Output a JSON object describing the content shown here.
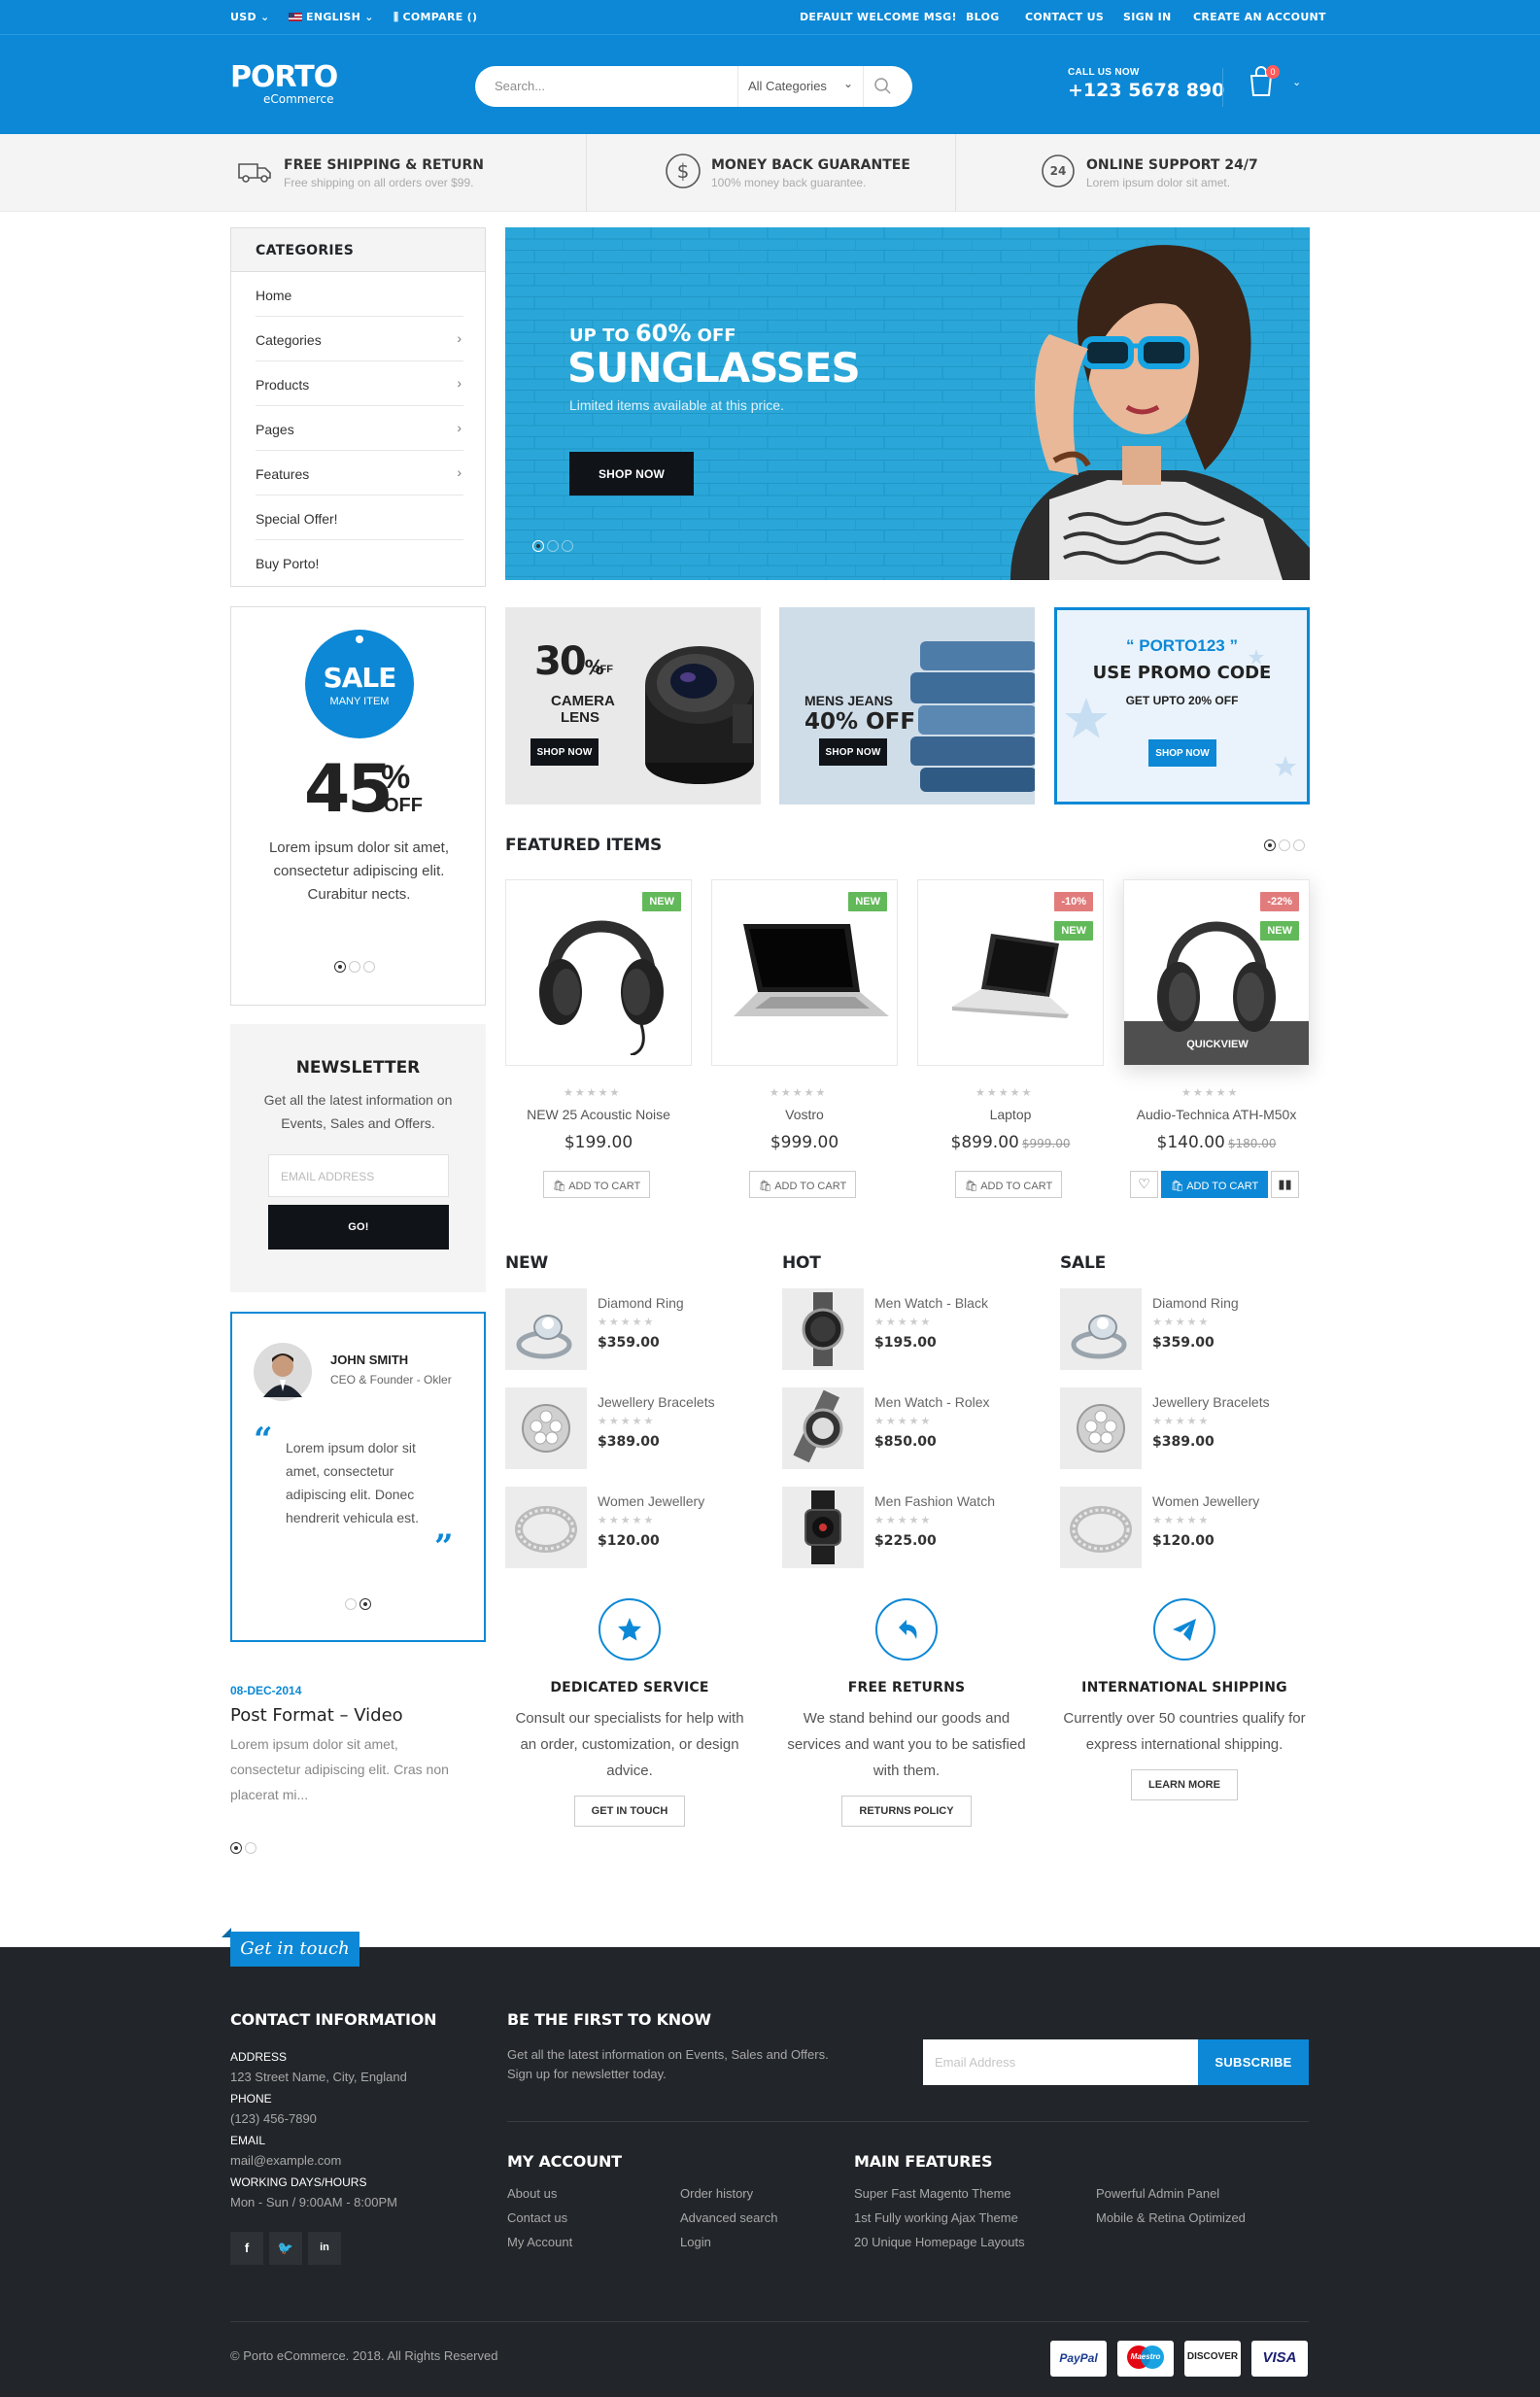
{
  "topbar": {
    "currency": "USD",
    "language": "ENGLISH",
    "compare": "COMPARE ()",
    "links": [
      "DEFAULT WELCOME MSG!",
      "BLOG",
      "CONTACT US",
      "SIGN IN",
      "CREATE AN ACCOUNT"
    ]
  },
  "header": {
    "logo_main": "PORTO",
    "logo_sub": "eCommerce",
    "search_placeholder": "Search...",
    "search_category": "All Categories",
    "call_label": "CALL US NOW",
    "phone": "+123 5678 890",
    "cart_count": "0"
  },
  "features": [
    {
      "title": "FREE SHIPPING & RETURN",
      "sub": "Free shipping on all orders over $99.",
      "icon": "truck-icon"
    },
    {
      "title": "MONEY BACK GUARANTEE",
      "sub": "100% money back guarantee.",
      "icon": "dollar-icon"
    },
    {
      "title": "ONLINE SUPPORT 24/7",
      "sub": "Lorem ipsum dolor sit amet.",
      "icon": "support-24-icon"
    }
  ],
  "categories": {
    "title": "CATEGORIES",
    "items": [
      "Home",
      "Categories",
      "Products",
      "Pages",
      "Features",
      "Special Offer!",
      "Buy Porto!"
    ]
  },
  "hero": {
    "pre": "UP TO",
    "percent": "60%",
    "off": "OFF",
    "title": "SUNGLASSES",
    "sub": "Limited items available at this price.",
    "button": "SHOP NOW"
  },
  "banners": {
    "camera": {
      "percent": "30",
      "pct_sign": "%",
      "off": "OFF",
      "line1": "CAMERA",
      "line2": "LENS",
      "button": "SHOP NOW"
    },
    "jeans": {
      "line1": "MENS JEANS",
      "line2": "40% OFF",
      "button": "SHOP NOW"
    },
    "promo": {
      "code": "“ PORTO123 ”",
      "line1": "USE PROMO CODE",
      "line2": "GET UPTO 20% OFF",
      "button": "SHOP NOW"
    }
  },
  "sale_box": {
    "badge_big": "SALE",
    "badge_small": "MANY ITEM",
    "percent": "45",
    "pct_sign": "%",
    "off": "OFF",
    "text": "Lorem ipsum dolor sit amet, consectetur adipiscing elit. Curabitur nects."
  },
  "newsletter": {
    "title": "NEWSLETTER",
    "text": "Get all the latest information on Events, Sales and Offers.",
    "placeholder": "EMAIL ADDRESS",
    "button": "GO!"
  },
  "testimonial": {
    "name": "JOHN SMITH",
    "role": "CEO & Founder - Okler",
    "quote": "Lorem ipsum dolor sit amet, consectetur adipiscing elit. Donec hendrerit vehicula est."
  },
  "blog": {
    "date": "08-DEC-2014",
    "title": "Post Format – Video",
    "excerpt": "Lorem ipsum dolor sit amet, consectetur adipiscing elit. Cras non placerat mi..."
  },
  "featured": {
    "title": "FEATURED ITEMS",
    "quickview": "QUICKVIEW",
    "add_to_cart": "ADD TO CART",
    "products": [
      {
        "name": "NEW 25 Acoustic Noise",
        "price": "$199.00",
        "old": "",
        "labels": [
          "NEW"
        ]
      },
      {
        "name": "Vostro",
        "price": "$999.00",
        "old": "",
        "labels": [
          "NEW"
        ]
      },
      {
        "name": "Laptop",
        "price": "$899.00",
        "old": "$999.00",
        "labels": [
          "-10%",
          "NEW"
        ]
      },
      {
        "name": "Audio-Technica ATH-M50x",
        "price": "$140.00",
        "old": "$180.00",
        "labels": [
          "-22%",
          "NEW"
        ]
      }
    ]
  },
  "lists": [
    {
      "title": "NEW",
      "items": [
        {
          "name": "Diamond Ring",
          "price": "$359.00"
        },
        {
          "name": "Jewellery Bracelets",
          "price": "$389.00"
        },
        {
          "name": "Women Jewellery",
          "price": "$120.00"
        }
      ]
    },
    {
      "title": "HOT",
      "items": [
        {
          "name": "Men Watch - Black",
          "price": "$195.00"
        },
        {
          "name": "Men Watch - Rolex",
          "price": "$850.00"
        },
        {
          "name": "Men Fashion Watch",
          "price": "$225.00"
        }
      ]
    },
    {
      "title": "SALE",
      "items": [
        {
          "name": "Diamond Ring",
          "price": "$359.00"
        },
        {
          "name": "Jewellery Bracelets",
          "price": "$389.00"
        },
        {
          "name": "Women Jewellery",
          "price": "$120.00"
        }
      ]
    }
  ],
  "services": [
    {
      "title": "DEDICATED SERVICE",
      "text": "Consult our specialists for help with an order, customization, or design advice.",
      "button": "GET IN TOUCH",
      "icon": "star-icon"
    },
    {
      "title": "FREE RETURNS",
      "text": "We stand behind our goods and services and want you to be satisfied with them.",
      "button": "RETURNS POLICY",
      "icon": "return-icon"
    },
    {
      "title": "INTERNATIONAL SHIPPING",
      "text": "Currently over 50 countries qualify for express international shipping.",
      "button": "LEARN MORE",
      "icon": "paper-plane-icon"
    }
  ],
  "footer": {
    "ribbon": "Get in touch",
    "contact_title": "CONTACT INFORMATION",
    "address_label": "ADDRESS",
    "address": "123 Street Name, City, England",
    "phone_label": "PHONE",
    "phone": "(123) 456-7890",
    "email_label": "EMAIL",
    "email": "mail@example.com",
    "hours_label": "WORKING DAYS/HOURS",
    "hours": "Mon - Sun / 9:00AM - 8:00PM",
    "know_title": "BE THE FIRST TO KNOW",
    "know_text1": "Get all the latest information on Events, Sales and Offers.",
    "know_text2": "Sign up for newsletter today.",
    "email_placeholder": "Email Address",
    "subscribe": "SUBSCRIBE",
    "account_title": "MY ACCOUNT",
    "account_col1": [
      "About us",
      "Contact us",
      "My Account"
    ],
    "account_col2": [
      "Order history",
      "Advanced search",
      "Login"
    ],
    "features_title": "MAIN FEATURES",
    "features_col1": [
      "Super Fast Magento Theme",
      "1st Fully working Ajax Theme",
      "20 Unique Homepage Layouts"
    ],
    "features_col2": [
      "Powerful Admin Panel",
      "Mobile & Retina Optimized"
    ],
    "social": [
      "f",
      "t",
      "in"
    ],
    "copyright": "© Porto eCommerce. 2018. All Rights Reserved",
    "payments": [
      "PayPal",
      "Maestro",
      "DISCOVER",
      "VISA"
    ]
  },
  "colors": {
    "primary": "#0c88d6",
    "dark": "#222529",
    "new_label": "#62b959",
    "sale_label": "#e27c7c"
  }
}
